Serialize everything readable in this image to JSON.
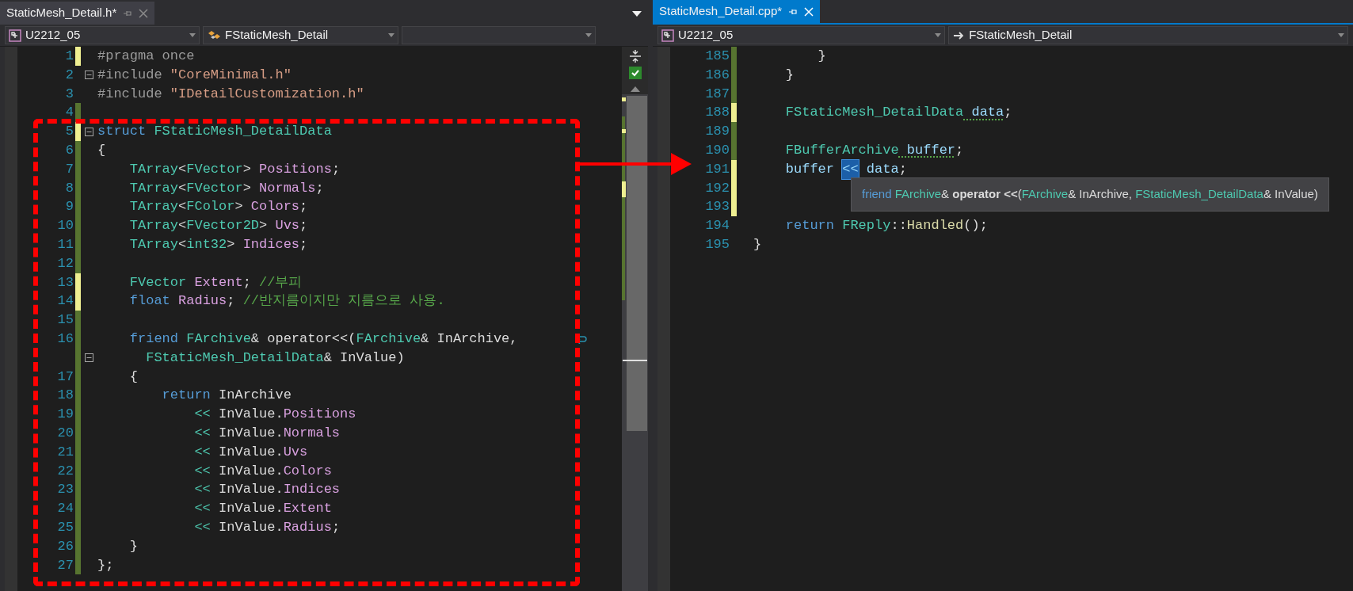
{
  "panes": [
    {
      "tab": {
        "title": "StaticMesh_Detail.h*",
        "selected": false
      },
      "combos": [
        {
          "kind": "project",
          "text": "U2212_05"
        },
        {
          "kind": "class",
          "text": "FStaticMesh_Detail"
        },
        {
          "kind": "empty"
        }
      ],
      "lines": [
        {
          "number": "1",
          "kind": "unsaved",
          "fold": false,
          "tokens": [
            {
              "text": "#pragma once",
              "kind": "pre"
            }
          ]
        },
        {
          "number": "2",
          "kind": "unchanged",
          "fold": true,
          "tokens": [
            {
              "text": "#include ",
              "kind": "pre"
            },
            {
              "text": "\"CoreMinimal.h\"",
              "kind": "str"
            }
          ]
        },
        {
          "number": "3",
          "kind": "unchanged",
          "fold": false,
          "tokens": [
            {
              "text": "#include ",
              "kind": "pre"
            },
            {
              "text": "\"IDetailCustomization.h\"",
              "kind": "str"
            }
          ]
        },
        {
          "number": "4",
          "kind": "saved",
          "fold": false
        },
        {
          "number": "5",
          "kind": "unsaved",
          "fold": true,
          "tokens": [
            {
              "text": "struct ",
              "kind": "kw"
            },
            {
              "text": "FStaticMesh_DetailData",
              "kind": "type"
            }
          ]
        },
        {
          "number": "6",
          "kind": "saved",
          "fold": false,
          "tokens": [
            {
              "text": "{",
              "kind": "plain"
            }
          ]
        },
        {
          "number": "7",
          "kind": "saved",
          "fold": false,
          "tokens": [
            {
              "text": "    TArray",
              "kind": "type"
            },
            {
              "text": "<",
              "kind": "plain"
            },
            {
              "text": "FVector",
              "kind": "type"
            },
            {
              "text": "> ",
              "kind": "plain"
            },
            {
              "text": "Positions",
              "kind": "member"
            },
            {
              "text": ";",
              "kind": "plain"
            }
          ]
        },
        {
          "number": "8",
          "kind": "saved",
          "fold": false,
          "tokens": [
            {
              "text": "    TArray",
              "kind": "type"
            },
            {
              "text": "<",
              "kind": "plain"
            },
            {
              "text": "FVector",
              "kind": "type"
            },
            {
              "text": "> ",
              "kind": "plain"
            },
            {
              "text": "Normals",
              "kind": "member"
            },
            {
              "text": ";",
              "kind": "plain"
            }
          ]
        },
        {
          "number": "9",
          "kind": "saved",
          "fold": false,
          "tokens": [
            {
              "text": "    TArray",
              "kind": "type"
            },
            {
              "text": "<",
              "kind": "plain"
            },
            {
              "text": "FColor",
              "kind": "type"
            },
            {
              "text": "> ",
              "kind": "plain"
            },
            {
              "text": "Colors",
              "kind": "member"
            },
            {
              "text": ";",
              "kind": "plain"
            }
          ]
        },
        {
          "number": "10",
          "kind": "saved",
          "fold": false,
          "tokens": [
            {
              "text": "    TArray",
              "kind": "type"
            },
            {
              "text": "<",
              "kind": "plain"
            },
            {
              "text": "FVector2D",
              "kind": "type"
            },
            {
              "text": "> ",
              "kind": "plain"
            },
            {
              "text": "Uvs",
              "kind": "member"
            },
            {
              "text": ";",
              "kind": "plain"
            }
          ]
        },
        {
          "number": "11",
          "kind": "saved",
          "fold": false,
          "tokens": [
            {
              "text": "    TArray",
              "kind": "type"
            },
            {
              "text": "<",
              "kind": "plain"
            },
            {
              "text": "int32",
              "kind": "type"
            },
            {
              "text": "> ",
              "kind": "plain"
            },
            {
              "text": "Indices",
              "kind": "member"
            },
            {
              "text": ";",
              "kind": "plain"
            }
          ]
        },
        {
          "number": "12",
          "kind": "saved",
          "fold": false
        },
        {
          "number": "13",
          "kind": "unsaved",
          "fold": false,
          "tokens": [
            {
              "text": "    FVector ",
              "kind": "type"
            },
            {
              "text": "Extent",
              "kind": "member"
            },
            {
              "text": "; ",
              "kind": "plain"
            },
            {
              "text": "//부피",
              "kind": "comment"
            }
          ]
        },
        {
          "number": "14",
          "kind": "unsaved",
          "fold": false,
          "tokens": [
            {
              "text": "    float ",
              "kind": "kw"
            },
            {
              "text": "Radius",
              "kind": "member"
            },
            {
              "text": "; ",
              "kind": "plain"
            },
            {
              "text": "//반지름이지만 지름으로 사용.",
              "kind": "comment"
            }
          ]
        },
        {
          "number": "15",
          "kind": "saved",
          "fold": false
        },
        {
          "number": "16",
          "kind": "saved",
          "fold": false,
          "tokens": [
            {
              "text": "    friend ",
              "kind": "kw"
            },
            {
              "text": "FArchive",
              "kind": "type"
            },
            {
              "text": "& operator<<(",
              "kind": "plain"
            },
            {
              "text": "FArchive",
              "kind": "type"
            },
            {
              "text": "& InArchive,",
              "kind": "plain"
            }
          ]
        },
        {
          "kind": "saved",
          "fold": true,
          "tokens": [
            {
              "text": "      FStaticMesh_DetailData",
              "kind": "type"
            },
            {
              "text": "& InValue)",
              "kind": "plain"
            }
          ]
        },
        {
          "number": "17",
          "kind": "saved",
          "fold": false,
          "tokens": [
            {
              "text": "    {",
              "kind": "plain"
            }
          ]
        },
        {
          "number": "18",
          "kind": "saved",
          "fold": false,
          "tokens": [
            {
              "text": "        return",
              "kind": "kw"
            },
            {
              "text": " InArchive",
              "kind": "plain"
            }
          ]
        },
        {
          "number": "19",
          "kind": "saved",
          "fold": false,
          "tokens": [
            {
              "text": "            <<",
              "kind": "opov"
            },
            {
              "text": " InValue.",
              "kind": "plain"
            },
            {
              "text": "Positions",
              "kind": "member"
            }
          ]
        },
        {
          "number": "20",
          "kind": "saved",
          "fold": false,
          "tokens": [
            {
              "text": "            <<",
              "kind": "opov"
            },
            {
              "text": " InValue.",
              "kind": "plain"
            },
            {
              "text": "Normals",
              "kind": "member"
            }
          ]
        },
        {
          "number": "21",
          "kind": "saved",
          "fold": false,
          "tokens": [
            {
              "text": "            <<",
              "kind": "opov"
            },
            {
              "text": " InValue.",
              "kind": "plain"
            },
            {
              "text": "Uvs",
              "kind": "member"
            }
          ]
        },
        {
          "number": "22",
          "kind": "saved",
          "fold": false,
          "tokens": [
            {
              "text": "            <<",
              "kind": "opov"
            },
            {
              "text": " InValue.",
              "kind": "plain"
            },
            {
              "text": "Colors",
              "kind": "member"
            }
          ]
        },
        {
          "number": "23",
          "kind": "saved",
          "fold": false,
          "tokens": [
            {
              "text": "            <<",
              "kind": "opov"
            },
            {
              "text": " InValue.",
              "kind": "plain"
            },
            {
              "text": "Indices",
              "kind": "member"
            }
          ]
        },
        {
          "number": "24",
          "kind": "saved",
          "fold": false,
          "tokens": [
            {
              "text": "            <<",
              "kind": "opov"
            },
            {
              "text": " InValue.",
              "kind": "plain"
            },
            {
              "text": "Extent",
              "kind": "member"
            }
          ]
        },
        {
          "number": "25",
          "kind": "saved",
          "fold": false,
          "tokens": [
            {
              "text": "            <<",
              "kind": "opov"
            },
            {
              "text": " InValue.",
              "kind": "plain"
            },
            {
              "text": "Radius",
              "kind": "member"
            },
            {
              "text": ";",
              "kind": "plain"
            }
          ]
        },
        {
          "number": "26",
          "kind": "saved",
          "fold": false,
          "tokens": [
            {
              "text": "    }",
              "kind": "plain"
            }
          ]
        },
        {
          "number": "27",
          "kind": "saved",
          "fold": false,
          "tokens": [
            {
              "text": "};",
              "kind": "plain"
            }
          ]
        }
      ]
    },
    {
      "tab": {
        "title": "StaticMesh_Detail.cpp*",
        "selected": true
      },
      "combos": [
        {
          "kind": "project",
          "text": "U2212_05"
        },
        {
          "kind": "arrow",
          "text": "FStaticMesh_Detail"
        }
      ],
      "lines": [
        {
          "number": "185",
          "kind": "saved",
          "fold": false,
          "tokens": [
            {
              "text": "        }",
              "kind": "plain"
            }
          ]
        },
        {
          "number": "186",
          "kind": "saved",
          "fold": false,
          "tokens": [
            {
              "text": "    }",
              "kind": "plain"
            }
          ]
        },
        {
          "number": "187",
          "kind": "saved",
          "fold": false
        },
        {
          "number": "188",
          "kind": "unsaved",
          "fold": false,
          "tokens": [
            {
              "text": "    FStaticMesh_DetailData",
              "kind": "type"
            },
            {
              "text": " data",
              "kind": "var-hint"
            },
            {
              "text": ";",
              "kind": "plain"
            }
          ]
        },
        {
          "number": "189",
          "kind": "saved",
          "fold": false
        },
        {
          "number": "190",
          "kind": "saved",
          "fold": false,
          "tokens": [
            {
              "text": "    FBufferArchive",
              "kind": "type"
            },
            {
              "text": " buffer",
              "kind": "var-hint"
            },
            {
              "text": ";",
              "kind": "plain"
            }
          ]
        },
        {
          "number": "191",
          "kind": "unsaved",
          "fold": false,
          "tokens": [
            {
              "text": "    buffer ",
              "kind": "var"
            },
            {
              "text": "<<",
              "kind": "op-highlight"
            },
            {
              "text": " data",
              "kind": "var"
            },
            {
              "text": ";",
              "kind": "plain"
            }
          ]
        },
        {
          "number": "192",
          "kind": "unsaved",
          "fold": false
        },
        {
          "number": "193",
          "kind": "unsaved",
          "fold": false
        },
        {
          "number": "194",
          "kind": "unchanged",
          "fold": false,
          "tokens": [
            {
              "text": "    return ",
              "kind": "kw"
            },
            {
              "text": "FReply",
              "kind": "type"
            },
            {
              "text": "::",
              "kind": "plain"
            },
            {
              "text": "Handled",
              "kind": "func"
            },
            {
              "text": "();",
              "kind": "plain"
            }
          ]
        },
        {
          "number": "195",
          "kind": "unchanged",
          "fold": false,
          "tokens": [
            {
              "text": "}",
              "kind": "plain"
            }
          ]
        }
      ],
      "tooltip": {
        "tokens": [
          {
            "text": "friend ",
            "kind": "kw"
          },
          {
            "text": "FArchive",
            "kind": "type"
          },
          {
            "text": "& ",
            "kind": "plain"
          },
          {
            "text": "operator <<",
            "kind": "bold"
          },
          {
            "text": "(",
            "kind": "plain"
          },
          {
            "text": "FArchive",
            "kind": "type"
          },
          {
            "text": "& InArchive, ",
            "kind": "plain"
          },
          {
            "text": "FStaticMesh_DetailData",
            "kind": "type"
          },
          {
            "text": "& InValue)",
            "kind": "plain"
          }
        ]
      }
    }
  ]
}
